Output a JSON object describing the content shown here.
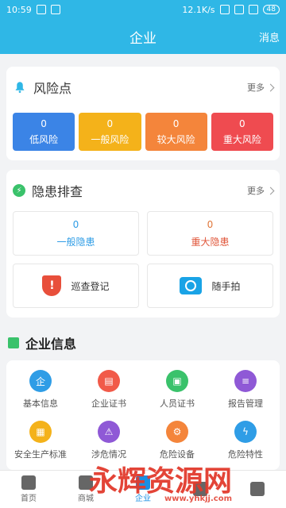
{
  "statusbar": {
    "time": "10:59",
    "speed": "12.1K/s",
    "battery": "48"
  },
  "header": {
    "title": "企业",
    "message_label": "消息"
  },
  "risk": {
    "title": "风险点",
    "more": "更多",
    "tiles": [
      {
        "value": "0",
        "label": "低风险",
        "color": "#3b84e6"
      },
      {
        "value": "0",
        "label": "一般风险",
        "color": "#f4b21a"
      },
      {
        "value": "0",
        "label": "较大风险",
        "color": "#f4853b"
      },
      {
        "value": "0",
        "label": "重大风险",
        "color": "#ef4b50"
      }
    ]
  },
  "hazard": {
    "title": "隐患排查",
    "more": "更多",
    "general": {
      "value": "0",
      "label": "一般隐患"
    },
    "major": {
      "value": "0",
      "label": "重大隐患"
    },
    "patrol": {
      "label": "巡查登记",
      "icon": "shield-exclamation-icon"
    },
    "snap": {
      "label": "随手拍",
      "icon": "camera-icon"
    }
  },
  "company": {
    "title": "企业信息",
    "items": [
      {
        "label": "基本信息",
        "icon": "basic-info-icon",
        "color": "#2f9de6"
      },
      {
        "label": "企业证书",
        "icon": "book-icon",
        "color": "#f15a49"
      },
      {
        "label": "人员证书",
        "icon": "person-cert-icon",
        "color": "#3ac26b"
      },
      {
        "label": "报告管理",
        "icon": "report-icon",
        "color": "#8f59d6"
      },
      {
        "label": "安全生产标准",
        "icon": "standard-icon",
        "color": "#f4b21a"
      },
      {
        "label": "涉危情况",
        "icon": "warning-icon",
        "color": "#8f59d6"
      },
      {
        "label": "危险设备",
        "icon": "device-icon",
        "color": "#f4853b"
      },
      {
        "label": "危险特性",
        "icon": "lightning-icon",
        "color": "#2f9de6"
      }
    ]
  },
  "bottom_nav": [
    {
      "label": "首页"
    },
    {
      "label": "商城"
    },
    {
      "label": "企业"
    },
    {
      "label": ""
    },
    {
      "label": ""
    }
  ],
  "watermark": {
    "text": "永辉资源网",
    "url": "www.yhkjj.com"
  }
}
